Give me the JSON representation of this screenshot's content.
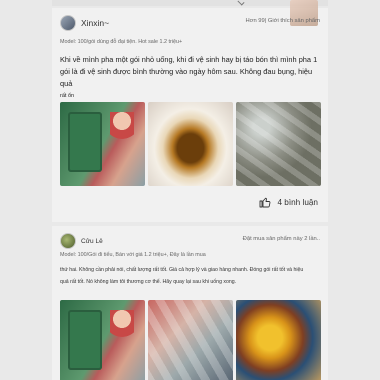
{
  "review1": {
    "username": "Xinxin~",
    "badge": "Hơn 99| Giới thích sản phẩm",
    "meta": "Model: 100/gói dùng đỗ đại tiện. Hot sale 1.2 triệu+",
    "text_line1": "Khi về mình pha một gói nhỏ uống, khi đi vệ sinh hay bị táo bón thì mình pha 1",
    "text_line2": "gói là đi vệ sinh được bình thường vào ngày hôm sau. Không đau bụng, hiệu quả",
    "text_line3": "rất ổn",
    "comment_count": "4 bình luận"
  },
  "review2": {
    "username": "Cửu Lê",
    "badge": "Đặt mua sản phẩm này 2 lần..",
    "meta": "Model: 100/Gói đi tiểu, Bán với giá 1.2 triệu+, Đây là lần mua",
    "text_line1": "thứ hai. Không cần phải nói, chất lượng rất tốt. Giá cả hợp lý và giao hàng nhanh. Đóng gói rất tốt và hiệu",
    "text_line2": "quả rất tốt. Nó không làm tôi thương cơ thể. Hãy quay lại sau khi uống xong."
  },
  "colors": {
    "background": "#e9e9e9",
    "card": "#f1f1f1",
    "text": "#222222",
    "muted": "#666666"
  },
  "icons": {
    "avatar1": "user-avatar",
    "avatar2": "user-avatar-green",
    "like": "thumbs-up-icon",
    "chevron": "chevron-down-icon"
  }
}
